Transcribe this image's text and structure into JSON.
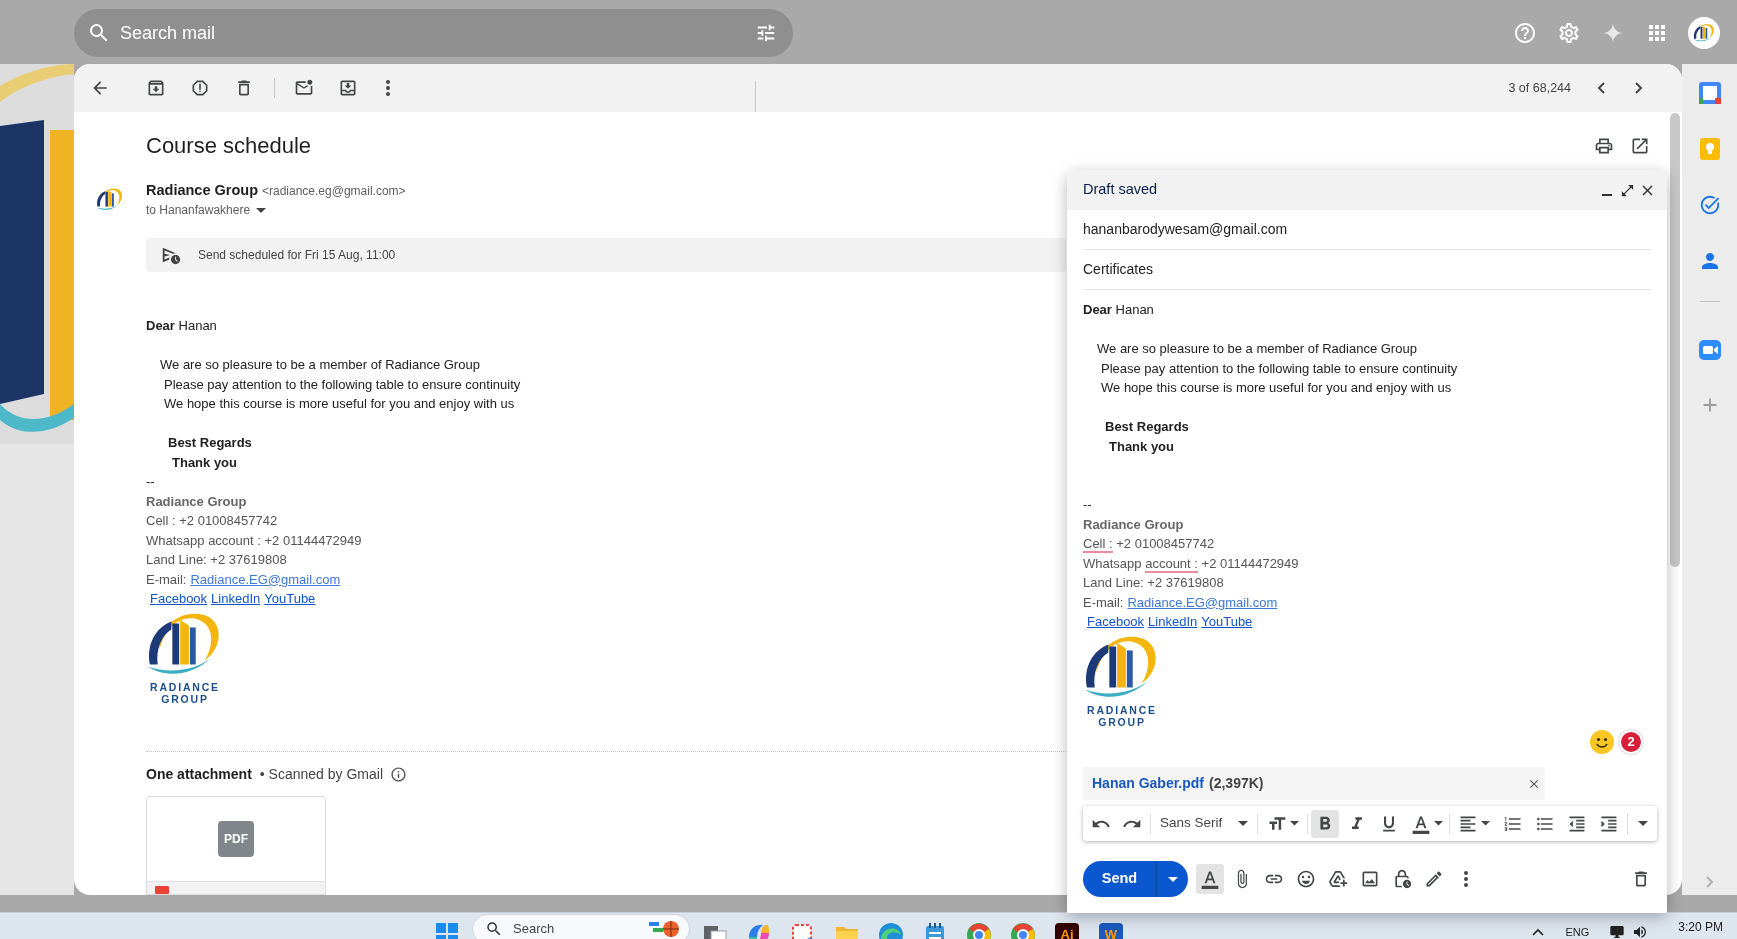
{
  "search": {
    "placeholder": "Search mail"
  },
  "toolbar": {
    "position": "3 of 68,244"
  },
  "message": {
    "subject": "Course schedule",
    "sender_name": "Radiance Group",
    "sender_email": "<radiance.eg@gmail.com>",
    "recipient": "to Hananfawakhere",
    "scheduled_notice": "Send scheduled for Fri 15 Aug, 11:00",
    "body": {
      "greeting": "**Dear** Hanan",
      "lines": [
        "We are so pleasure to be a member of Radiance Group",
        "Please pay attention to the following table to ensure continuity",
        "We hope this course is more useful for you and enjoy with us"
      ],
      "closing": [
        "Best Regards",
        "Thank you"
      ]
    },
    "signature": {
      "separator": "--",
      "name": "Radiance Group",
      "contact_lines": [
        "Cell : +2 01008457742",
        "Whatsapp account : +2 01144472949",
        "Land Line: +2 37619808"
      ],
      "email_label": "E-mail:",
      "email": "Radiance.EG@gmail.com",
      "links": [
        "Facebook",
        "LinkedIn",
        "YouTube"
      ],
      "logo_text": [
        "RADIANCE",
        "GROUP"
      ]
    },
    "attachments": {
      "title": "One attachment",
      "scan_note": "• Scanned by Gmail",
      "files": [
        {
          "type_label": "PDF"
        }
      ]
    }
  },
  "compose": {
    "status": "Draft saved",
    "to": "hananbarodywesam@gmail.com",
    "subject": "Certificates",
    "body": {
      "greeting": "**Dear** Hanan",
      "lines": [
        "We are so pleasure to be a member of Radiance Group",
        "Please pay attention to the following table to ensure continuity",
        "We hope this course is more useful for you and enjoy with us"
      ],
      "closing": [
        "Best Regards",
        "Thank you"
      ]
    },
    "signature": {
      "separator": "--",
      "name": "Radiance Group",
      "contact_lines": [
        {
          "parts": [
            {
              "text": "Cell :",
              "misspelled": true
            },
            {
              "text": "+2 01008457742",
              "misspelled": false
            }
          ]
        },
        {
          "parts": [
            {
              "text": "Whatsapp",
              "misspelled": false
            },
            {
              "text": "account :",
              "misspelled": true
            },
            {
              "text": "+2 01144472949",
              "misspelled": false
            }
          ]
        },
        {
          "parts": [
            {
              "text": "Land Line: +2 37619808",
              "misspelled": false
            }
          ]
        }
      ],
      "email_label": "E-mail:",
      "email": "Radiance.EG@gmail.com",
      "links": [
        "Facebook",
        "LinkedIn",
        "YouTube"
      ],
      "logo_text": [
        "RADIANCE",
        "GROUP"
      ]
    },
    "extension_badge": "2",
    "attachment": {
      "name": "Hanan Gaber.pdf",
      "size": "(2,397K)"
    },
    "format_toolbar": {
      "font": "Sans Serif",
      "bold": true,
      "italic": false,
      "underline": false
    },
    "formatting_toggle": {
      "selected": true
    },
    "send_label": "Send"
  },
  "taskbar": {
    "search_placeholder": "Search",
    "apps": [
      {
        "kind": "squares"
      },
      {
        "kind": "swirl"
      },
      {
        "kind": "frame"
      },
      {
        "kind": "folder"
      },
      {
        "kind": "wave"
      },
      {
        "kind": "notepad"
      },
      {
        "kind": "ring"
      },
      {
        "kind": "ring"
      },
      {
        "kind": "letter_tile",
        "label": "Ai",
        "color": "#330000"
      },
      {
        "kind": "letter_tile",
        "label": "W",
        "color": "#185abd"
      }
    ],
    "language": "ENG",
    "time": "3:20 PM"
  }
}
